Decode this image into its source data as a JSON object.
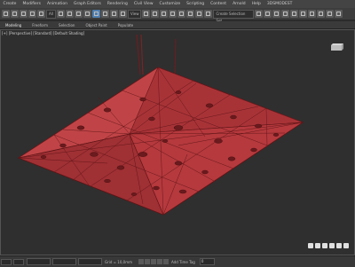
{
  "menu": {
    "items": [
      "Create",
      "Modifiers",
      "Animation",
      "Graph Editors",
      "Rendering",
      "Civil View",
      "Customize",
      "Scripting",
      "Content",
      "Arnold",
      "Help",
      "3DSMODEST"
    ]
  },
  "toolbar": {
    "view_select": "All",
    "named_selection_placeholder": "Create Selection Set"
  },
  "ribbon": {
    "tabs": [
      "Modeling",
      "Freeform",
      "Selection",
      "Object Paint",
      "Populate"
    ]
  },
  "viewport": {
    "label": "[+] [Perspective] [Standard] [Default Shading]",
    "colors": {
      "mesh_fill": "#b53a3e",
      "mesh_edge": "#5e1416",
      "mesh_shadow": "#7d2226"
    }
  },
  "status": {
    "grid": "Grid = 10,0mm",
    "add_time_tag": "Add Time Tag",
    "frame": "0"
  },
  "navigation": {
    "icons": [
      "zoom-icon",
      "zoom-all-icon",
      "fov-icon",
      "pan-icon",
      "orbit-icon",
      "maximize-viewport-icon"
    ]
  }
}
